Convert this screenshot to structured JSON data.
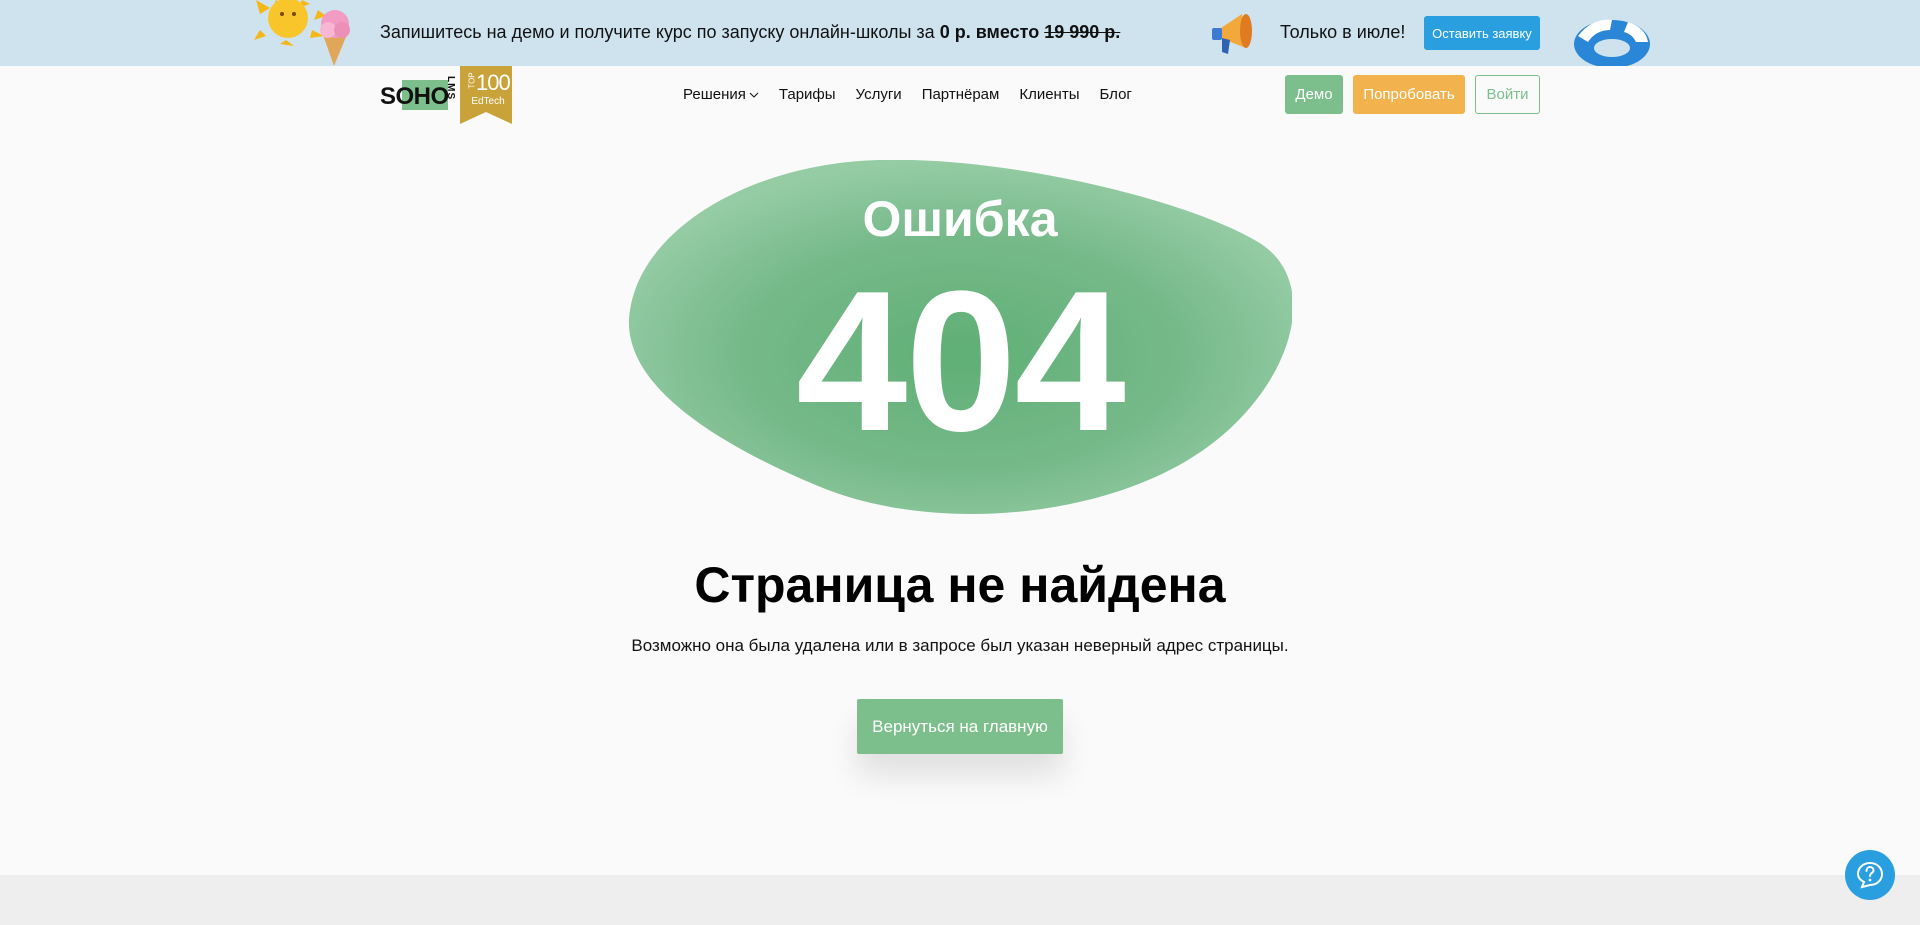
{
  "promo": {
    "text_start": "Запишитесь на демо и получите курс по запуску онлайн-школы за ",
    "price_new": "0 р.",
    "between": " вместо ",
    "price_old": "19 990 р.",
    "only_text": "Только в июле!",
    "button_label": "Оставить заявку"
  },
  "logo": {
    "brand": "SOHO",
    "suffix": "LMS",
    "badge_top": "TOP",
    "badge_number": "100",
    "badge_sub": "EdTech"
  },
  "nav": {
    "items": [
      {
        "label": "Решения",
        "has_dropdown": true
      },
      {
        "label": "Тарифы"
      },
      {
        "label": "Услуги"
      },
      {
        "label": "Партнёрам"
      },
      {
        "label": "Клиенты"
      },
      {
        "label": "Блог"
      }
    ]
  },
  "header_buttons": {
    "demo": "Демо",
    "try": "Попробовать",
    "login": "Войти"
  },
  "error": {
    "word": "Ошибка",
    "code": "404",
    "title": "Страница не найдена",
    "subtitle": "Возможно она была удалена или в запросе был указан неверный адрес страницы.",
    "home_button": "Вернуться на главную"
  },
  "colors": {
    "accent_green": "#7dbf8c",
    "accent_orange": "#f2b24e",
    "accent_blue": "#2a9fe0",
    "promo_bg": "#cfe3ef"
  },
  "icons": [
    "sun-icon",
    "ice-cream-icon",
    "megaphone-icon",
    "swim-ring-icon",
    "chevron-down-icon",
    "help-question-icon"
  ]
}
